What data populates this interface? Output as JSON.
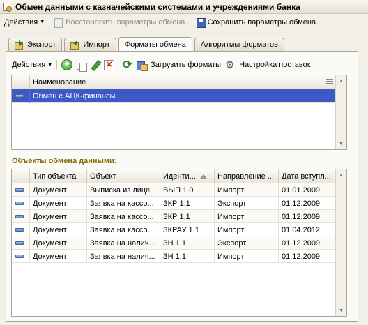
{
  "window": {
    "title": "Обмен данными с казначейскими системами и учреждениями банка"
  },
  "toolbar": {
    "actions_label": "Действия",
    "restore_label": "Восстановить параметры обмена...",
    "save_label": "Сохранить параметры обмена..."
  },
  "tabs": [
    {
      "label": "Экспорт",
      "icon": "export-icon"
    },
    {
      "label": "Импорт",
      "icon": "import-icon"
    },
    {
      "label": "Форматы обмена",
      "active": true
    },
    {
      "label": "Алгоритмы форматов"
    }
  ],
  "panel_toolbar": {
    "actions_label": "Действия",
    "load_formats_label": "Загрузить форматы",
    "delivery_settings_label": "Настройка поставок"
  },
  "formats_table": {
    "header": "Наименование",
    "rows": [
      {
        "name": "Обмен с АЦК-финансы",
        "selected": true
      }
    ]
  },
  "objects_section": {
    "title": "Объекты обмена данными:",
    "columns": [
      "Тип объекта",
      "Объект",
      "Иденти...",
      "Направление ...",
      "Дата вступл..."
    ],
    "rows": [
      [
        "Документ",
        "Выписка из лице...",
        "ВЫП 1.0",
        "Импорт",
        "01.01.2009"
      ],
      [
        "Документ",
        "Заявка на кассо...",
        "ЗКР 1.1",
        "Экспорт",
        "01.12.2009"
      ],
      [
        "Документ",
        "Заявка на кассо...",
        "ЗКР 1.1",
        "Импорт",
        "01.12.2009"
      ],
      [
        "Документ",
        "Заявка на кассо...",
        "ЗКРАУ 1.1",
        "Импорт",
        "01.04.2012"
      ],
      [
        "Документ",
        "Заявка на налич...",
        "ЗН 1.1",
        "Экспорт",
        "01.12.2009"
      ],
      [
        "Документ",
        "Заявка на налич...",
        "ЗН 1.1",
        "Импорт",
        "01.12.2009"
      ]
    ]
  }
}
